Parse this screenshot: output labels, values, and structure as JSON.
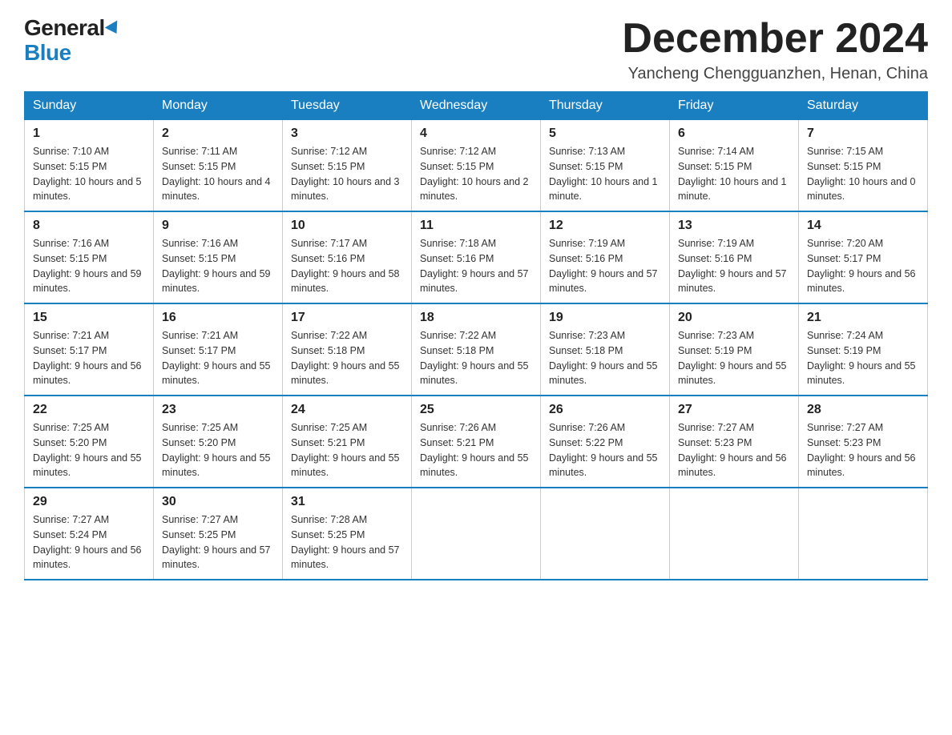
{
  "logo": {
    "general": "General",
    "blue": "Blue"
  },
  "header": {
    "title": "December 2024",
    "location": "Yancheng Chengguanzhen, Henan, China"
  },
  "days_of_week": [
    "Sunday",
    "Monday",
    "Tuesday",
    "Wednesday",
    "Thursday",
    "Friday",
    "Saturday"
  ],
  "weeks": [
    [
      {
        "day": "1",
        "sunrise": "7:10 AM",
        "sunset": "5:15 PM",
        "daylight": "10 hours and 5 minutes."
      },
      {
        "day": "2",
        "sunrise": "7:11 AM",
        "sunset": "5:15 PM",
        "daylight": "10 hours and 4 minutes."
      },
      {
        "day": "3",
        "sunrise": "7:12 AM",
        "sunset": "5:15 PM",
        "daylight": "10 hours and 3 minutes."
      },
      {
        "day": "4",
        "sunrise": "7:12 AM",
        "sunset": "5:15 PM",
        "daylight": "10 hours and 2 minutes."
      },
      {
        "day": "5",
        "sunrise": "7:13 AM",
        "sunset": "5:15 PM",
        "daylight": "10 hours and 1 minute."
      },
      {
        "day": "6",
        "sunrise": "7:14 AM",
        "sunset": "5:15 PM",
        "daylight": "10 hours and 1 minute."
      },
      {
        "day": "7",
        "sunrise": "7:15 AM",
        "sunset": "5:15 PM",
        "daylight": "10 hours and 0 minutes."
      }
    ],
    [
      {
        "day": "8",
        "sunrise": "7:16 AM",
        "sunset": "5:15 PM",
        "daylight": "9 hours and 59 minutes."
      },
      {
        "day": "9",
        "sunrise": "7:16 AM",
        "sunset": "5:15 PM",
        "daylight": "9 hours and 59 minutes."
      },
      {
        "day": "10",
        "sunrise": "7:17 AM",
        "sunset": "5:16 PM",
        "daylight": "9 hours and 58 minutes."
      },
      {
        "day": "11",
        "sunrise": "7:18 AM",
        "sunset": "5:16 PM",
        "daylight": "9 hours and 57 minutes."
      },
      {
        "day": "12",
        "sunrise": "7:19 AM",
        "sunset": "5:16 PM",
        "daylight": "9 hours and 57 minutes."
      },
      {
        "day": "13",
        "sunrise": "7:19 AM",
        "sunset": "5:16 PM",
        "daylight": "9 hours and 57 minutes."
      },
      {
        "day": "14",
        "sunrise": "7:20 AM",
        "sunset": "5:17 PM",
        "daylight": "9 hours and 56 minutes."
      }
    ],
    [
      {
        "day": "15",
        "sunrise": "7:21 AM",
        "sunset": "5:17 PM",
        "daylight": "9 hours and 56 minutes."
      },
      {
        "day": "16",
        "sunrise": "7:21 AM",
        "sunset": "5:17 PM",
        "daylight": "9 hours and 55 minutes."
      },
      {
        "day": "17",
        "sunrise": "7:22 AM",
        "sunset": "5:18 PM",
        "daylight": "9 hours and 55 minutes."
      },
      {
        "day": "18",
        "sunrise": "7:22 AM",
        "sunset": "5:18 PM",
        "daylight": "9 hours and 55 minutes."
      },
      {
        "day": "19",
        "sunrise": "7:23 AM",
        "sunset": "5:18 PM",
        "daylight": "9 hours and 55 minutes."
      },
      {
        "day": "20",
        "sunrise": "7:23 AM",
        "sunset": "5:19 PM",
        "daylight": "9 hours and 55 minutes."
      },
      {
        "day": "21",
        "sunrise": "7:24 AM",
        "sunset": "5:19 PM",
        "daylight": "9 hours and 55 minutes."
      }
    ],
    [
      {
        "day": "22",
        "sunrise": "7:25 AM",
        "sunset": "5:20 PM",
        "daylight": "9 hours and 55 minutes."
      },
      {
        "day": "23",
        "sunrise": "7:25 AM",
        "sunset": "5:20 PM",
        "daylight": "9 hours and 55 minutes."
      },
      {
        "day": "24",
        "sunrise": "7:25 AM",
        "sunset": "5:21 PM",
        "daylight": "9 hours and 55 minutes."
      },
      {
        "day": "25",
        "sunrise": "7:26 AM",
        "sunset": "5:21 PM",
        "daylight": "9 hours and 55 minutes."
      },
      {
        "day": "26",
        "sunrise": "7:26 AM",
        "sunset": "5:22 PM",
        "daylight": "9 hours and 55 minutes."
      },
      {
        "day": "27",
        "sunrise": "7:27 AM",
        "sunset": "5:23 PM",
        "daylight": "9 hours and 56 minutes."
      },
      {
        "day": "28",
        "sunrise": "7:27 AM",
        "sunset": "5:23 PM",
        "daylight": "9 hours and 56 minutes."
      }
    ],
    [
      {
        "day": "29",
        "sunrise": "7:27 AM",
        "sunset": "5:24 PM",
        "daylight": "9 hours and 56 minutes."
      },
      {
        "day": "30",
        "sunrise": "7:27 AM",
        "sunset": "5:25 PM",
        "daylight": "9 hours and 57 minutes."
      },
      {
        "day": "31",
        "sunrise": "7:28 AM",
        "sunset": "5:25 PM",
        "daylight": "9 hours and 57 minutes."
      },
      null,
      null,
      null,
      null
    ]
  ],
  "labels": {
    "sunrise": "Sunrise:",
    "sunset": "Sunset:",
    "daylight": "Daylight:"
  }
}
